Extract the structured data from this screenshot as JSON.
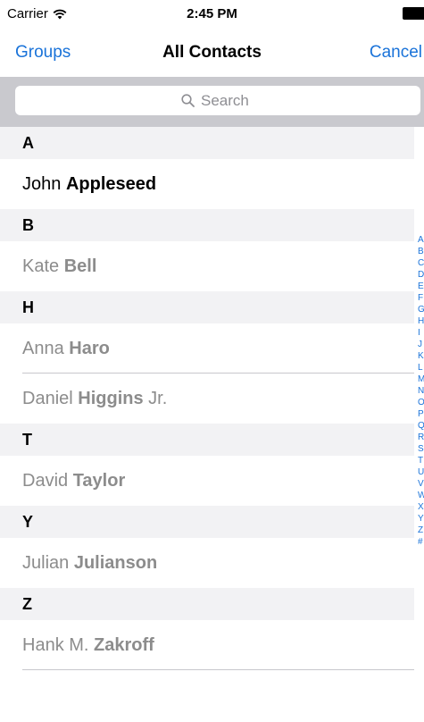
{
  "status_bar": {
    "carrier": "Carrier",
    "time": "2:45 PM"
  },
  "nav": {
    "left_button": "Groups",
    "title": "All Contacts",
    "right_button": "Cancel"
  },
  "search": {
    "placeholder": "Search"
  },
  "sections": [
    {
      "letter": "A",
      "contacts": [
        {
          "first": "John",
          "last": "Appleseed",
          "suffix": ""
        }
      ]
    },
    {
      "letter": "B",
      "contacts": [
        {
          "first": "Kate",
          "last": "Bell",
          "suffix": ""
        }
      ]
    },
    {
      "letter": "H",
      "contacts": [
        {
          "first": "Anna",
          "last": "Haro",
          "suffix": ""
        },
        {
          "first": "Daniel",
          "last": "Higgins",
          "suffix": "Jr."
        }
      ]
    },
    {
      "letter": "T",
      "contacts": [
        {
          "first": "David",
          "last": "Taylor",
          "suffix": ""
        }
      ]
    },
    {
      "letter": "Y",
      "contacts": [
        {
          "first": "Julian",
          "last": "Julianson",
          "suffix": ""
        }
      ]
    },
    {
      "letter": "Z",
      "contacts": [
        {
          "first": "Hank M.",
          "last": "Zakroff",
          "suffix": ""
        }
      ]
    }
  ],
  "section_index": [
    "A",
    "B",
    "C",
    "D",
    "E",
    "F",
    "G",
    "H",
    "I",
    "J",
    "K",
    "L",
    "M",
    "N",
    "O",
    "P",
    "Q",
    "R",
    "S",
    "T",
    "U",
    "V",
    "W",
    "X",
    "Y",
    "Z",
    "#"
  ],
  "colors": {
    "accent": "#1a73d9",
    "section_header_bg": "#f2f2f4",
    "search_bar_bg": "#c9c9ce"
  }
}
